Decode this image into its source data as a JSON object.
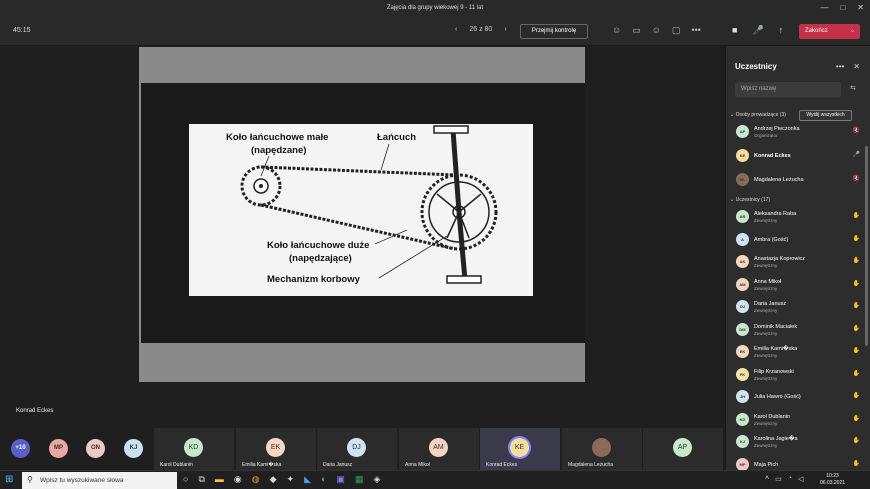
{
  "window": {
    "title": "Zajęcia dla grupy wiekowej 9 - 11 lat",
    "min": "—",
    "max": "□",
    "close": "✕"
  },
  "toolbar": {
    "timer": "45:15",
    "prev": "‹",
    "page": "26 z 80",
    "next": "›",
    "take_control": "Przejmij kontrolę",
    "end": "Zakończ",
    "end_chev": "⌄",
    "icons": {
      "participants": "☺",
      "chat": "▭",
      "reactions": "☺",
      "rooms": "▢",
      "more": "•••",
      "camera": "■",
      "mic": "🎤",
      "share": "↑"
    }
  },
  "slide": {
    "labels": {
      "small": "Koło łańcuchowe małe",
      "small_sub": "(napędzane)",
      "chain": "Łańcuch",
      "big": "Koło łańcuchowe duże",
      "big_sub": "(napędzające)",
      "crank": "Mechanizm korbowy"
    }
  },
  "presenter": "Konrad Eckes",
  "strip": {
    "more": "+10",
    "minis": [
      {
        "i": "MP",
        "c": "#e8a9a0"
      },
      {
        "i": "ON",
        "c": "#f0c8c8"
      },
      {
        "i": "KJ",
        "c": "#c9e2f0"
      }
    ],
    "tiles": [
      {
        "i": "KD",
        "name": "Karol Dublanin",
        "c": "#c7e8cc"
      },
      {
        "i": "EK",
        "name": "Emilia Kami�ska",
        "c": "#f6d7c0"
      },
      {
        "i": "DJ",
        "name": "Daria Janusz",
        "c": "#cfe4f3"
      },
      {
        "i": "AM",
        "name": "Anna Mikoł",
        "c": "#f3d3c1"
      },
      {
        "i": "KE",
        "name": "Konrad Eckes",
        "c": "#f7dd9b"
      },
      {
        "i": "ML",
        "name": "Magdalena Leżucha",
        "c": "#8a6a5a"
      },
      {
        "i": "AP",
        "name": "",
        "c": "#c7e8cc"
      }
    ]
  },
  "panel": {
    "title": "Uczestnicy",
    "more": "•••",
    "close": "✕",
    "search_placeholder": "Wpisz nazwę",
    "share": "⇆",
    "presenters_label": "Osoby prowadzące (3)",
    "show_all": "Wyślij wszystkich",
    "attendees_label": "Uczestnicy (17)",
    "presenters": [
      {
        "i": "AP",
        "name": "Andrzej Pieczonka",
        "sub": "Organizator",
        "c": "#c7e8cc",
        "mic": "🔇"
      },
      {
        "i": "KE",
        "name": "Konrad Eckes",
        "sub": "",
        "c": "#f7dd9b",
        "mic": "🎤"
      },
      {
        "i": "ML",
        "name": "Magdalena Leżucha",
        "sub": "",
        "c": "#8a6a5a",
        "mic": "🔇"
      }
    ],
    "attendees": [
      {
        "i": "AR",
        "name": "Aleksandra Raba",
        "sub": "Zewnętrzny",
        "c": "#c7e8cc"
      },
      {
        "i": "A",
        "name": "Ambra (Gość)",
        "sub": "",
        "c": "#cfe4f3"
      },
      {
        "i": "AK",
        "name": "Anastazja Koprowicz",
        "sub": "Zewnętrzny",
        "c": "#f6d7c0"
      },
      {
        "i": "AM",
        "name": "Anna Mikoł",
        "sub": "Zewnętrzny",
        "c": "#f3d3c1"
      },
      {
        "i": "DJ",
        "name": "Daria Janusz",
        "sub": "Zewnętrzny",
        "c": "#cfe4f3"
      },
      {
        "i": "DM",
        "name": "Dominik Maciałek",
        "sub": "Zewnętrzny",
        "c": "#c7e8cc"
      },
      {
        "i": "EK",
        "name": "Emilia Kami�ska",
        "sub": "Zewnętrzny",
        "c": "#f6d7c0"
      },
      {
        "i": "FK",
        "name": "Filip Krzanowski",
        "sub": "Zewnętrzny",
        "c": "#f7e3a8"
      },
      {
        "i": "JH",
        "name": "Julia Hawro (Gość)",
        "sub": "",
        "c": "#cfe4f3"
      },
      {
        "i": "KD",
        "name": "Karol Dublanin",
        "sub": "Zewnętrzny",
        "c": "#c7e8cc"
      },
      {
        "i": "KJ",
        "name": "Karolina Jagie�a",
        "sub": "Zewnętrzny",
        "c": "#c7e8cc"
      },
      {
        "i": "MP",
        "name": "Maja Pich",
        "sub": "",
        "c": "#f0c8c8"
      }
    ]
  },
  "taskbar": {
    "search_placeholder": "Wpisz tu wyszukiwane słowa",
    "time": "10:23",
    "date": "06.03.2021"
  }
}
